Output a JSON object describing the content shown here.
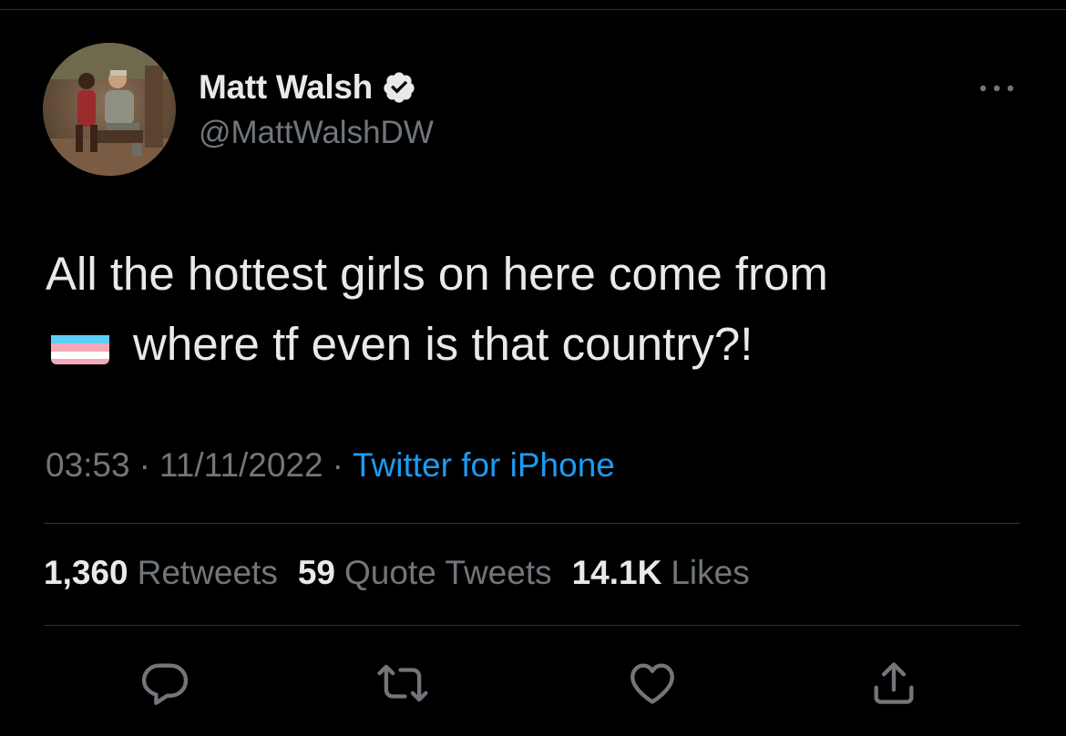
{
  "author": {
    "name": "Matt Walsh",
    "handle": "@MattWalshDW",
    "verified": true
  },
  "tweet": {
    "text_line1": "All the hottest girls on here come from",
    "text_line2": "where tf even is that country?!",
    "flag_emoji": "transgender-flag"
  },
  "meta": {
    "time": "03:53",
    "date": "11/11/2022",
    "separator": "·",
    "source": "Twitter for iPhone"
  },
  "stats": {
    "retweets_count": "1,360",
    "retweets_label": "Retweets",
    "quotes_count": "59",
    "quotes_label": "Quote Tweets",
    "likes_count": "14.1K",
    "likes_label": "Likes"
  },
  "actions": {
    "reply_icon": "reply-icon",
    "retweet_icon": "retweet-icon",
    "like_icon": "like-icon",
    "share_icon": "share-icon"
  },
  "colors": {
    "background": "#000000",
    "primary_text": "#e7e9ea",
    "secondary_text": "#71767b",
    "link": "#1d9bf0",
    "divider": "#2f3336"
  }
}
